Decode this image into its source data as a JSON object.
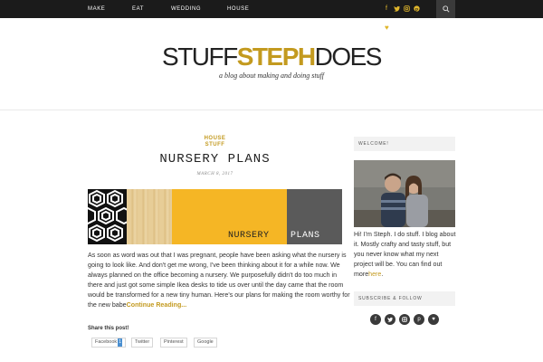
{
  "nav": {
    "links": [
      "MAKE",
      "EAT",
      "WEDDING",
      "HOUSE"
    ],
    "social_icons": [
      "facebook-icon",
      "twitter-icon",
      "instagram-icon",
      "pinterest-icon"
    ],
    "search_icon": "search-icon"
  },
  "header": {
    "logo_part1": "STUFF",
    "logo_part2": "STEPH",
    "logo_part3": "DOES",
    "tagline": "a blog about making and doing stuff",
    "heart_icon": "heart-icon"
  },
  "post": {
    "categories": [
      "HOUSE",
      "STUFF"
    ],
    "title": "NURSERY PLANS",
    "date": "MARCH 8, 2017",
    "image_text_1": "NURSERY",
    "image_text_2": "PLANS",
    "excerpt": "As soon as word was out that I was pregnant, people have been asking what the nursery is going to look like. And don't get me wrong, I've been thinking about it for a while now. We always planned on the office becoming a nursery. We purposefully didn't do too much in there and just got some simple Ikea desks to tide us over until the day came that the room would be transformed for a new tiny human. Here's our plans for making the room worthy for the new babe",
    "read_more": "Continue Reading...",
    "share_label": "Share this post!",
    "share_buttons": [
      "Facebook",
      "Twitter",
      "Pinterest",
      "Google"
    ],
    "facebook_count": "1"
  },
  "sidebar": {
    "welcome_title": "WELCOME!",
    "bio": "Hi! I'm Steph. I do stuff. I blog about it. Mostly crafty and tasty stuff, but you never know what my next project will be. You can find out more",
    "bio_link": "here",
    "bio_end": ".",
    "follow_title": "SUBSCRIBE & FOLLOW",
    "follow_icons": [
      "facebook-icon",
      "twitter-icon",
      "instagram-icon",
      "pinterest-icon",
      "bloglovin-heart-icon"
    ]
  },
  "colors": {
    "accent": "#c39a1f",
    "nav_bg": "#1b1b1b",
    "banner_yellow": "#f5b625",
    "banner_gray": "#5a5a5a"
  }
}
